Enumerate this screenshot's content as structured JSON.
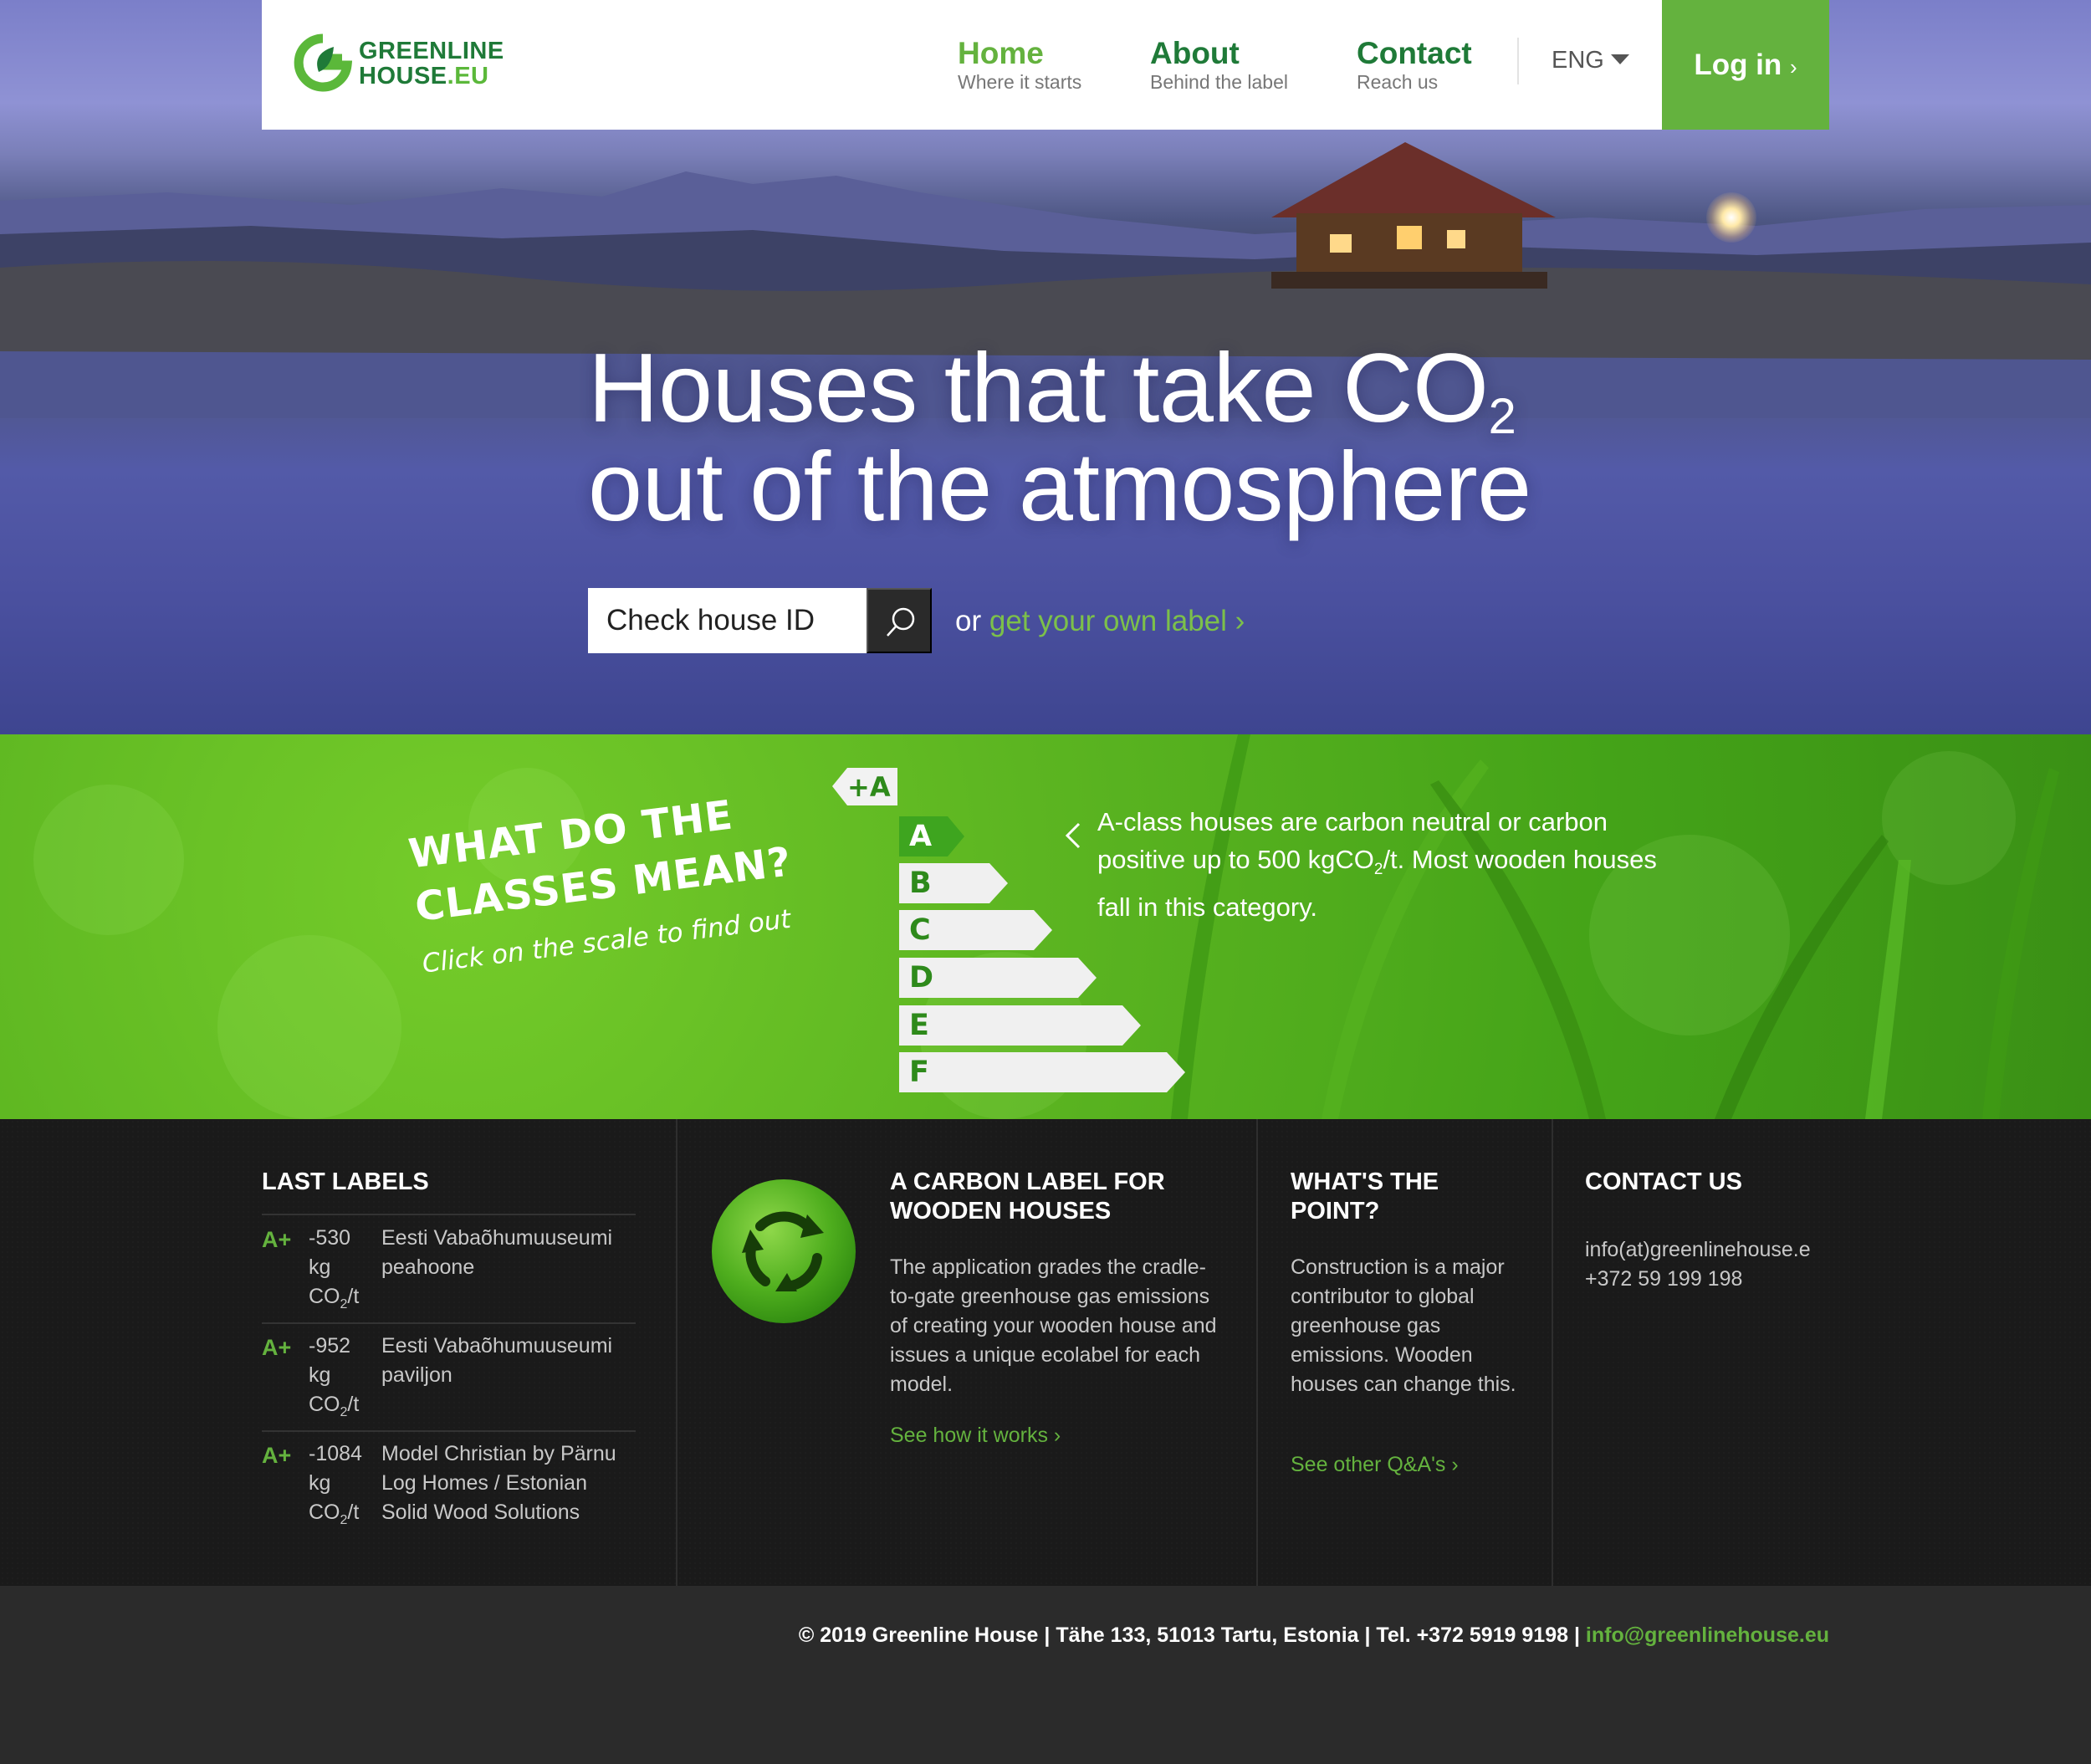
{
  "brand": {
    "line1": "GREENLINE",
    "line2a": "HOUSE",
    "line2b": ".EU"
  },
  "nav": {
    "items": [
      {
        "title": "Home",
        "sub": "Where it starts"
      },
      {
        "title": "About",
        "sub": "Behind the label"
      },
      {
        "title": "Contact",
        "sub": "Reach us"
      }
    ],
    "language": "ENG",
    "login": "Log in",
    "login_chevron": "›"
  },
  "hero": {
    "headline_line1": "Houses that take CO",
    "headline_sub": "2",
    "headline_line2": "out of the atmosphere",
    "search_placeholder": "Check house ID",
    "or": "or",
    "own_label_link": "get your own label ›"
  },
  "classes": {
    "title_line1": "WHAT DO THE",
    "title_line2": "CLASSES MEAN?",
    "subtitle": "Click on the scale to find out",
    "scale": [
      "+A",
      "A",
      "B",
      "C",
      "D",
      "E",
      "F"
    ],
    "info_part1": "A-class houses are carbon neutral or carbon positive up to 500 kgCO",
    "info_sub": "2",
    "info_part2": "/t. Most wooden houses fall in this category."
  },
  "last_labels": {
    "heading": "LAST LABELS",
    "items": [
      {
        "grade": "A+",
        "value": "-530",
        "unit_kg": "kg",
        "unit_co": "CO",
        "unit_sub": "2",
        "unit_t": "/t",
        "name": "Eesti Vabaõhumuuseumi peahoone"
      },
      {
        "grade": "A+",
        "value": "-952",
        "unit_kg": "kg",
        "unit_co": "CO",
        "unit_sub": "2",
        "unit_t": "/t",
        "name": "Eesti Vabaõhumuuseumi paviljon"
      },
      {
        "grade": "A+",
        "value": "-1084",
        "unit_kg": "kg",
        "unit_co": "CO",
        "unit_sub": "2",
        "unit_t": "/t",
        "name": "Model Christian by Pärnu Log Homes / Estonian Solid Wood Solutions"
      }
    ]
  },
  "carbon_label": {
    "heading": "A CARBON LABEL FOR WOODEN HOUSES",
    "text": "The application grades the cradle-to-gate greenhouse gas emissions of creating your wooden house and issues a unique ecolabel for each model.",
    "link": "See how it works ›"
  },
  "point": {
    "heading": "WHAT'S THE POINT?",
    "text": "Construction is a major contributor to global greenhouse gas emissions. Wooden houses can change this.",
    "link": "See other Q&A's ›"
  },
  "contact": {
    "heading": "CONTACT US",
    "email": "info(at)greenlinehouse.e",
    "phone": "+372 59 199 198"
  },
  "footer": {
    "copyright": "© 2019 Greenline House | Tähe 133, 51013 Tartu, Estonia | Tel. +372 5919 9198 |",
    "email": "info@greenlinehouse.eu"
  },
  "colors": {
    "brand_green": "#64b23e",
    "dark_green": "#1f7a38",
    "footer_bg": "#1a1a1a"
  }
}
